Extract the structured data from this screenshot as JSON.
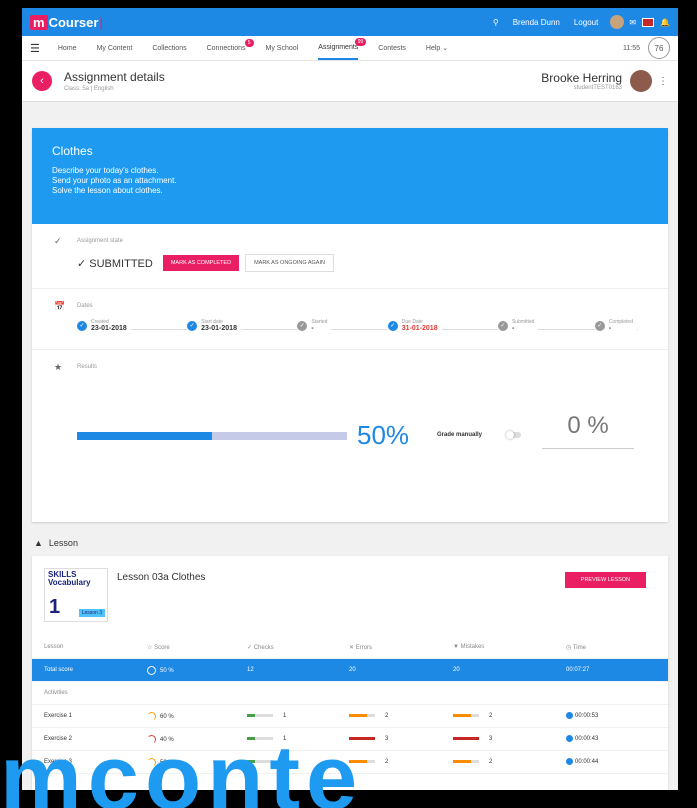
{
  "topbar": {
    "logo_m": "m",
    "logo_text": "Courser",
    "user": "Brenda Dunn",
    "logout": "Logout"
  },
  "nav": {
    "items": [
      {
        "label": "Home",
        "badge": ""
      },
      {
        "label": "My Content",
        "badge": ""
      },
      {
        "label": "Collections",
        "badge": ""
      },
      {
        "label": "Connections",
        "badge": "5"
      },
      {
        "label": "My School",
        "badge": ""
      },
      {
        "label": "Assignments",
        "badge": "99"
      },
      {
        "label": "Contests",
        "badge": ""
      },
      {
        "label": "Help ⌄",
        "badge": ""
      }
    ],
    "time": "11:55",
    "medal": "76"
  },
  "header": {
    "title": "Assignment details",
    "subtitle": "Class: 5a | English",
    "student_name": "Brooke Herring",
    "student_id": "studentTEST0163"
  },
  "assignment": {
    "title": "Clothes",
    "lines": [
      "Describe your today's clothes.",
      "Send your photo as an attachment.",
      "Solve the lesson about clothes."
    ]
  },
  "status": {
    "label": "Assignment state",
    "value": "SUBMITTED",
    "mark_completed": "MARK AS COMPLETED",
    "mark_ongoing": "MARK AS ONGOING AGAIN"
  },
  "dates": {
    "label": "Dates",
    "items": [
      {
        "label": "Created",
        "value": "23-01-2018"
      },
      {
        "label": "Start date",
        "value": "23-01-2018"
      },
      {
        "label": "Started",
        "value": "-"
      },
      {
        "label": "Due Date",
        "value": "31-01-2018"
      },
      {
        "label": "Submitted",
        "value": "-"
      },
      {
        "label": "Completed",
        "value": "-"
      }
    ]
  },
  "results": {
    "label": "Results",
    "progress": 0.5,
    "percent": "50%",
    "grade_manually": "Grade manually",
    "grade": "0 %"
  },
  "lesson": {
    "section": "Lesson",
    "title": "Lesson 03a Clothes",
    "preview": "PREVIEW LESSON",
    "thumb_line1": "SKILLS",
    "thumb_line2": "Vocabulary",
    "thumb_num": "1",
    "thumb_lesson": "Lesson 3",
    "headers": [
      "Lesson",
      "Score",
      "Checks",
      "Errors",
      "Mistakes",
      "Time"
    ],
    "total": [
      "Total score",
      "50 %",
      "12",
      "20",
      "20",
      "00:07:27"
    ],
    "activities_label": "Activities",
    "rows": [
      [
        "Exercise 1",
        "60 %",
        "1",
        "2",
        "2",
        "00:00:53"
      ],
      [
        "Exercise 2",
        "40 %",
        "1",
        "3",
        "3",
        "00:00:43"
      ],
      [
        "Exercise 3",
        "50 %",
        "1",
        "2",
        "2",
        "00:00:44"
      ]
    ]
  },
  "watermark": "mconte"
}
